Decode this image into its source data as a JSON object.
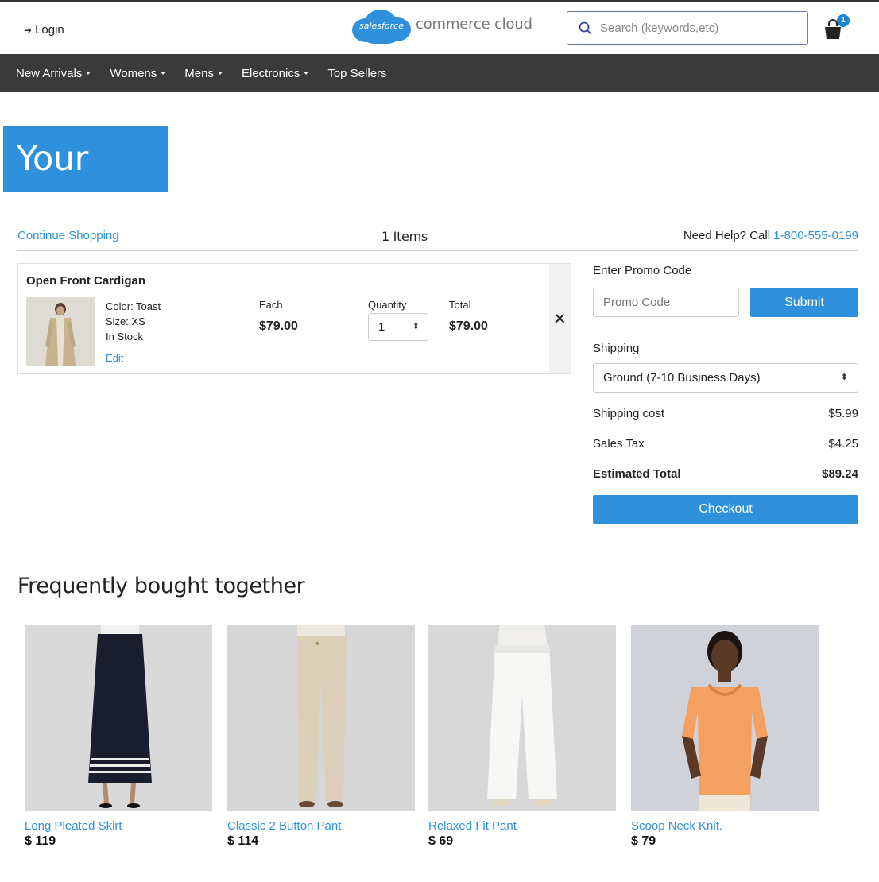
{
  "header": {
    "login_label": "Login",
    "logo_cloud_text": "salesforce",
    "logo_text": "commerce cloud",
    "search_placeholder": "Search (keywords,etc)",
    "cart_count": "1"
  },
  "nav": {
    "items": [
      {
        "label": "New Arrivals",
        "dropdown": true
      },
      {
        "label": "Womens",
        "dropdown": true
      },
      {
        "label": "Mens",
        "dropdown": true
      },
      {
        "label": "Electronics",
        "dropdown": true
      },
      {
        "label": "Top Sellers",
        "dropdown": false
      }
    ]
  },
  "cart": {
    "title": "Your Cart",
    "continue_label": "Continue Shopping",
    "item_count": "1 Items",
    "help_prefix": "Need Help? Call ",
    "help_phone": "1-800-555-0199"
  },
  "line_item": {
    "name": "Open Front Cardigan",
    "color": "Color: Toast",
    "size": "Size: XS",
    "stock": "In Stock",
    "edit_label": "Edit",
    "each_label": "Each",
    "each_value": "$79.00",
    "quantity_label": "Quantity",
    "quantity_value": "1",
    "total_label": "Total",
    "total_value": "$79.00",
    "remove_glyph": "✕"
  },
  "summary": {
    "promo_label": "Enter Promo Code",
    "promo_placeholder": "Promo Code",
    "submit_label": "Submit",
    "shipping_label": "Shipping",
    "shipping_method": "Ground (7-10 Business Days)",
    "shipping_cost_label": "Shipping cost",
    "shipping_cost_value": "$5.99",
    "sales_tax_label": "Sales Tax",
    "sales_tax_value": "$4.25",
    "estimated_total_label": "Estimated Total",
    "estimated_total_value": "$89.24",
    "checkout_label": "Checkout"
  },
  "recommendations": {
    "title": "Frequently bought together",
    "products": [
      {
        "name": "Long Pleated Skirt",
        "price": "$ 119"
      },
      {
        "name": "Classic 2 Button Pant.",
        "price": "$ 114"
      },
      {
        "name": "Relaxed Fit Pant",
        "price": "$ 69"
      },
      {
        "name": "Scoop Neck Knit.",
        "price": "$ 79"
      }
    ]
  },
  "colors": {
    "accent": "#2f91db",
    "nav_bg": "#3a3a3a"
  }
}
